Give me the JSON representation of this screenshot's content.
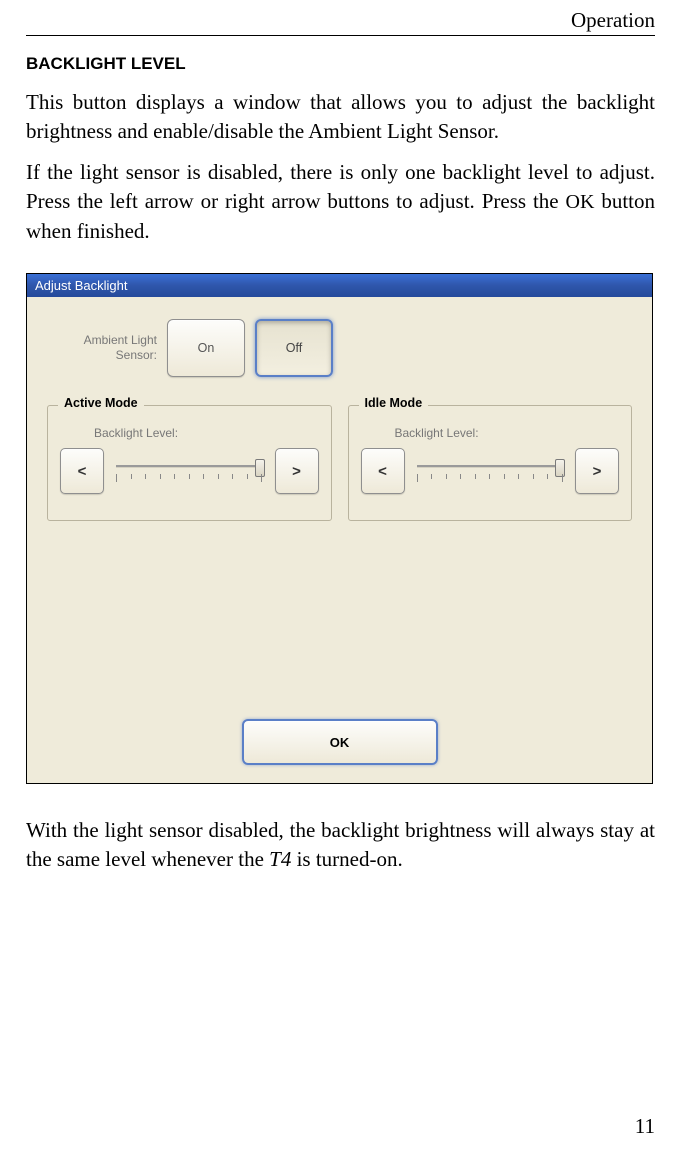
{
  "header": {
    "section": "Operation"
  },
  "heading": "BACKLIGHT LEVEL",
  "para1": "This button displays a window that allows you to adjust the backlight brightness and enable/disable the Ambient Light Sensor.",
  "para2a": "If the light sensor is disabled, there is only one backlight level to adjust. Press the left arrow or right arrow buttons to adjust. Press the ",
  "para2_ok": "OK",
  "para2b": " button when finished.",
  "dialog": {
    "title": "Adjust Backlight",
    "als_label": "Ambient Light Sensor:",
    "on_label": "On",
    "off_label": "Off",
    "active_mode": {
      "legend": "Active Mode",
      "bl_label": "Backlight Level:",
      "left": "<",
      "right": ">"
    },
    "idle_mode": {
      "legend": "Idle Mode",
      "bl_label": "Backlight Level:",
      "left": "<",
      "right": ">"
    },
    "ok_label": "OK"
  },
  "para3a": "With the light sensor disabled, the backlight brightness will always stay at the same level whenever the ",
  "para3_t4": "T4",
  "para3b": " is turned-on.",
  "page_number": "11"
}
